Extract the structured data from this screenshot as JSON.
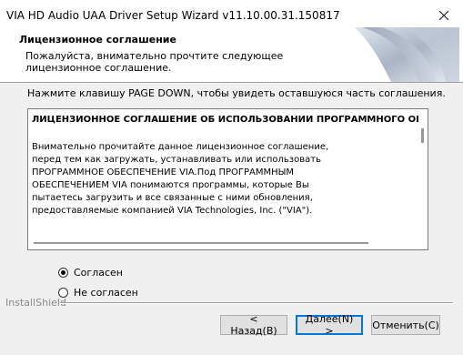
{
  "window": {
    "title": "VIA HD Audio UAA Driver Setup Wizard v11.10.00.31.150817",
    "close_icon": "close-icon"
  },
  "header": {
    "title": "Лицензионное соглашение",
    "subtitle": "Пожалуйста, внимательно прочтите следующее лицензионное соглашение.",
    "graphic_icon": "wizard-page-curl-graphic"
  },
  "instruction": "Нажмите клавишу PAGE DOWN, чтобы увидеть оставшуюся часть соглашения.",
  "license": {
    "heading": "ЛИЦЕНЗИОННОЕ СОГЛАШЕНИЕ ОБ ИСПОЛЬЗОВАНИИ ПРОГРАММНОГО ОБЕСП",
    "body": "Внимательно прочитайте данное лицензионное соглашение, перед тем как загружать, устанавливать или использовать ПРОГРАММНОЕ ОБЕСПЕЧЕНИЕ VIA.Под ПРОГРАММНЫМ ОБЕСПЕЧЕНИЕМ VIA понимаются программы, которые Вы пытаетесь загрузить и все связанные с ними обновления, предоставляемые компанией VIA Technologies, Inc. (\"VIA\")."
  },
  "options": {
    "agree": "Согласен",
    "disagree": "Не согласен",
    "selected": "agree"
  },
  "footer": {
    "brand": "InstallShield"
  },
  "buttons": {
    "back": "< Назад(B)",
    "next": "Далее(N) >",
    "cancel": "Отменить(C)"
  },
  "colors": {
    "accent": "#0078d7"
  }
}
